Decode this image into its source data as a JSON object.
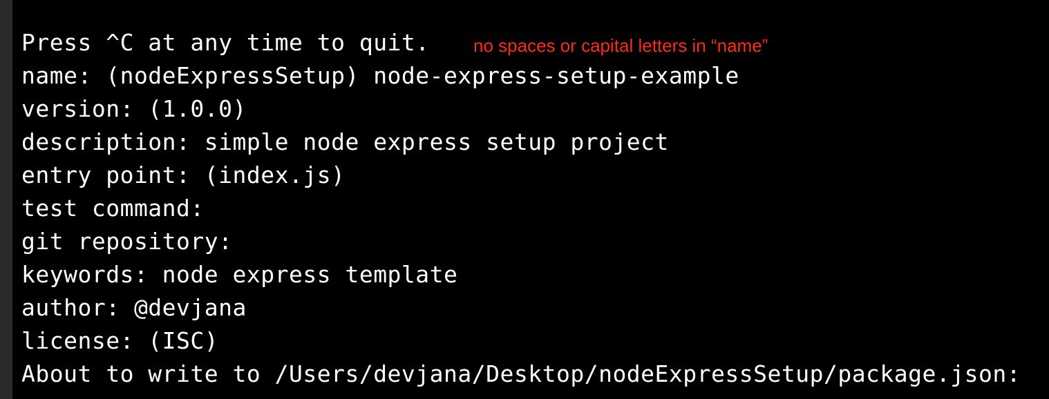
{
  "terminal": {
    "lines": [
      "Press ^C at any time to quit.",
      "name: (nodeExpressSetup) node-express-setup-example",
      "version: (1.0.0)",
      "description: simple node express setup project",
      "entry point: (index.js)",
      "test command:",
      "git repository:",
      "keywords: node express template",
      "author: @devjana",
      "license: (ISC)",
      "About to write to /Users/devjana/Desktop/nodeExpressSetup/package.json:"
    ]
  },
  "annotation": {
    "text": "no spaces or capital letters in “name”",
    "color": "#ff2a1a"
  },
  "colors": {
    "background": "#000000",
    "text": "#ffffff",
    "edge": "#2a2a2a"
  }
}
